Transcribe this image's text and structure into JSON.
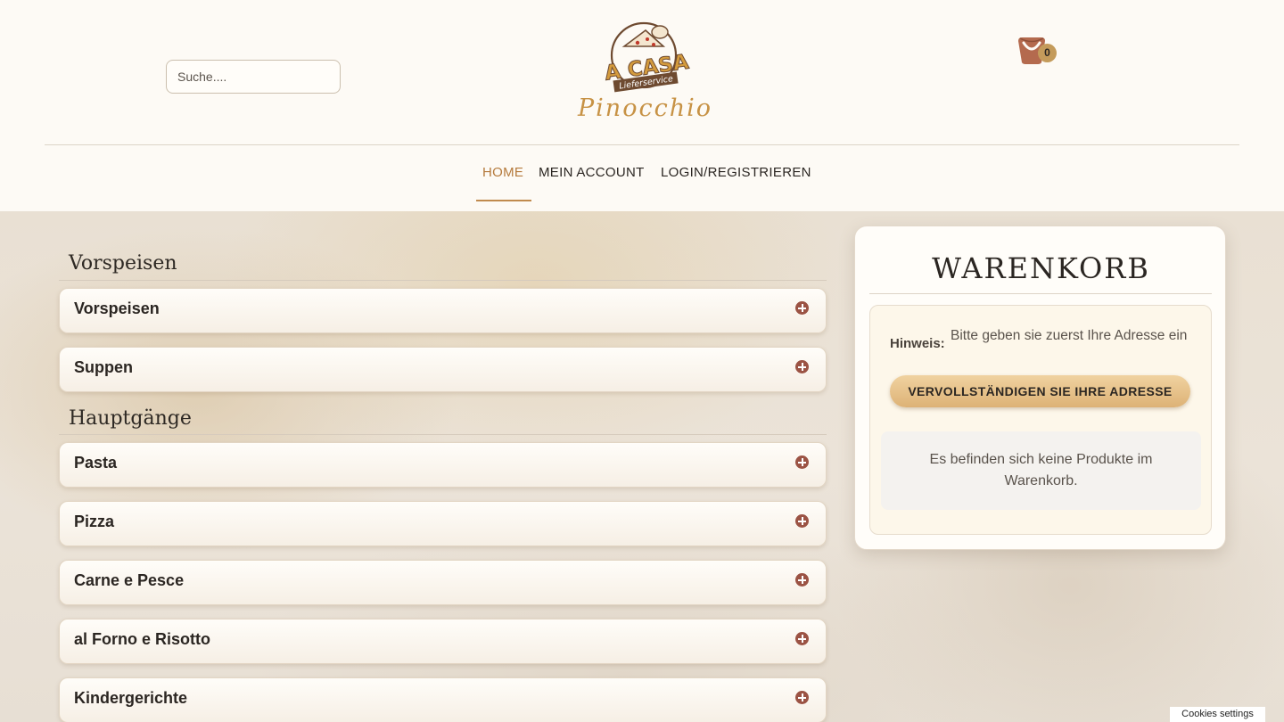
{
  "search": {
    "placeholder": "Suche...."
  },
  "logo": {
    "brand_text": "A CASA",
    "sub_text": "Lieferservice",
    "script_text": "Pinocchio"
  },
  "cart_badge": {
    "count": "0"
  },
  "nav": {
    "items": [
      {
        "label": "HOME",
        "active": true
      },
      {
        "label": "MEIN ACCOUNT",
        "active": false
      },
      {
        "label": "LOGIN/REGISTRIEREN",
        "active": false
      }
    ]
  },
  "menu": {
    "sections": [
      {
        "heading": "Vorspeisen",
        "categories": [
          {
            "label": "Vorspeisen"
          },
          {
            "label": "Suppen"
          }
        ]
      },
      {
        "heading": "Hauptgänge",
        "categories": [
          {
            "label": "Pasta"
          },
          {
            "label": "Pizza"
          },
          {
            "label": "Carne e Pesce"
          },
          {
            "label": "al Forno e Risotto"
          },
          {
            "label": "Kindergerichte"
          }
        ]
      }
    ]
  },
  "cart": {
    "title": "WARENKORB",
    "hint_label": "Hinweis:",
    "hint_text": "Bitte geben sie zuerst Ihre Adresse ein",
    "address_button": "VERVOLLSTÄNDIGEN SIE IHRE ADRESSE",
    "empty_message": "Es befinden sich keine Produkte im Warenkorb."
  },
  "cookies": {
    "label": "Cookies settings"
  },
  "colors": {
    "accent": "#b57a3c",
    "plus_icon": "#9b5344",
    "button_gold": "#ddb276",
    "header_bg": "#fdfaf5"
  }
}
